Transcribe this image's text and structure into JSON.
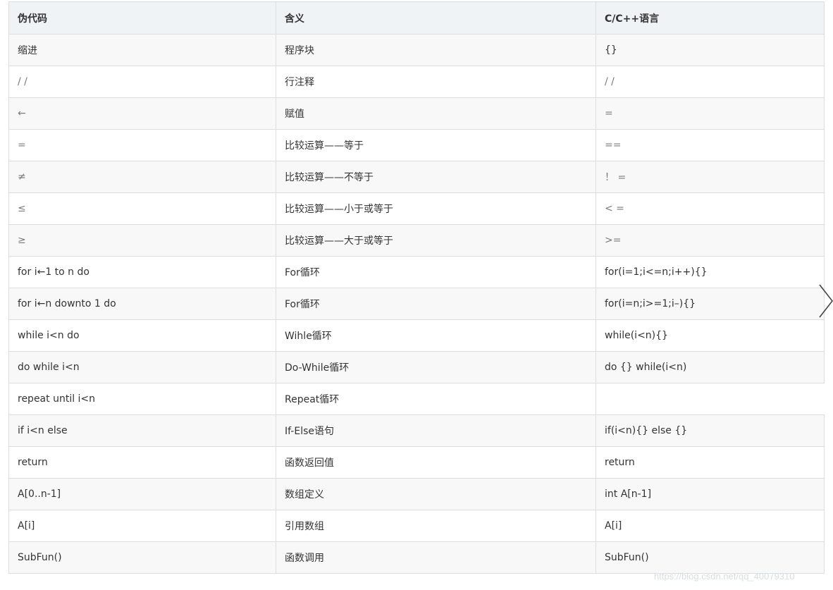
{
  "table": {
    "headers": [
      "伪代码",
      "含义",
      "C/C++语言"
    ],
    "rows": [
      [
        "缩进",
        "程序块",
        "{}"
      ],
      [
        "/ /",
        "行注释",
        "/ /"
      ],
      [
        "←",
        "赋值",
        "="
      ],
      [
        "=",
        "比较运算——等于",
        "=="
      ],
      [
        "≠",
        "比较运算——不等于",
        "！ ="
      ],
      [
        "≤",
        "比较运算——小于或等于",
        "< ="
      ],
      [
        "≥",
        "比较运算——大于或等于",
        ">="
      ],
      [
        "for i←1 to n do",
        "For循环",
        "for(i=1;i<=n;i++){}"
      ],
      [
        "for i←n downto 1 do",
        "For循环",
        "for(i=n;i>=1;i–){}"
      ],
      [
        "while i<n do",
        "Wihle循环",
        "while(i<n){}"
      ],
      [
        "do while i<n",
        "Do-While循环",
        "do {} while(i<n)"
      ],
      [
        "repeat until i<n",
        "Repeat循环",
        ""
      ],
      [
        "if i<n else",
        "If-Else语句",
        "if(i<n){} else {}"
      ],
      [
        "return",
        "函数返回值",
        "return"
      ],
      [
        "A[0..n-1]",
        "数组定义",
        "int A[n-1]"
      ],
      [
        "A[i]",
        "引用数组",
        "A[i]"
      ],
      [
        "SubFun()",
        "函数调用",
        "SubFun()"
      ]
    ]
  },
  "watermark": "https://blog.csdn.net/qq_40079310",
  "icons": {
    "next": "chevron-right-icon"
  },
  "colors": {
    "header_bg": "#eff3f5",
    "stripe_bg": "#f8f8f8",
    "border": "#dddddd",
    "text": "#333333"
  }
}
